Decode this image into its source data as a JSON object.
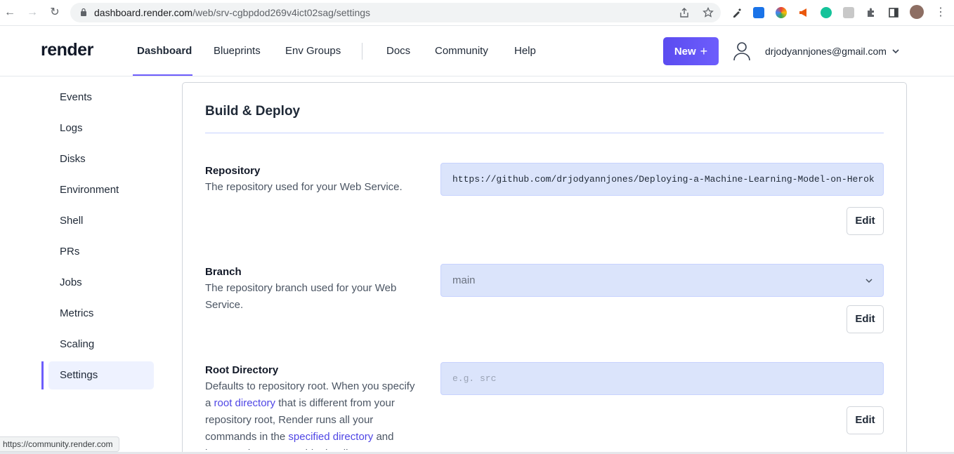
{
  "browser": {
    "url_host": "dashboard.render.com",
    "url_path": "/web/srv-cgbpdod269v4ict02sag/settings",
    "status_url": "https://community.render.com"
  },
  "header": {
    "logo": "render",
    "nav": [
      {
        "label": "Dashboard",
        "active": true
      },
      {
        "label": "Blueprints"
      },
      {
        "label": "Env Groups"
      },
      {
        "label": "Docs"
      },
      {
        "label": "Community"
      },
      {
        "label": "Help"
      }
    ],
    "new_button": "New",
    "new_icon": "+",
    "user_email": "drjodyannjones@gmail.com"
  },
  "sidebar": {
    "items": [
      {
        "label": "Events"
      },
      {
        "label": "Logs"
      },
      {
        "label": "Disks"
      },
      {
        "label": "Environment"
      },
      {
        "label": "Shell"
      },
      {
        "label": "PRs"
      },
      {
        "label": "Jobs"
      },
      {
        "label": "Metrics"
      },
      {
        "label": "Scaling"
      },
      {
        "label": "Settings",
        "active": true
      }
    ]
  },
  "main": {
    "section_title": "Build & Deploy",
    "repository": {
      "label": "Repository",
      "description": "The repository used for your Web Service.",
      "value": "https://github.com/drjodyannjones/Deploying-a-Machine-Learning-Model-on-Heroku-",
      "edit": "Edit"
    },
    "branch": {
      "label": "Branch",
      "description": "The repository branch used for your Web Service.",
      "value": "main",
      "edit": "Edit"
    },
    "root_directory": {
      "label": "Root Directory",
      "desc_1": "Defaults to repository root. When you specify a ",
      "link_1": "root directory",
      "desc_2": " that is different from your repository root, Render runs all your commands in the ",
      "link_2": "specified directory",
      "desc_3": " and ignores changes outside the directory.",
      "placeholder": "e.g. src",
      "edit": "Edit"
    }
  },
  "colors": {
    "accent": "#6d5dfc",
    "field_bg": "#dbe4fb",
    "link": "#4f46e5"
  }
}
